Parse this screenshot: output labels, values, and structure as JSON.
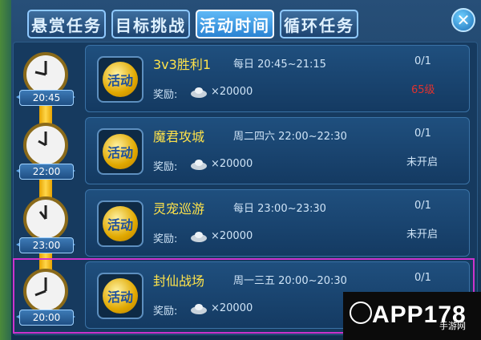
{
  "tabs": [
    {
      "label": "悬赏任务"
    },
    {
      "label": "目标挑战"
    },
    {
      "label": "活动时间"
    },
    {
      "label": "循环任务"
    }
  ],
  "active_tab": "活动时间",
  "close_glyph": "✕",
  "reward_label": "奖励:",
  "badge_text": "活动",
  "events": [
    {
      "time": "20:45",
      "name": "3v3胜利1",
      "schedule": "每日 20:45~21:15",
      "count": "0/1",
      "status": "65级",
      "reward": "×20000"
    },
    {
      "time": "22:00",
      "name": "魔君攻城",
      "schedule": "周二四六 22:00~22:30",
      "count": "0/1",
      "status": "未开启",
      "reward": "×20000"
    },
    {
      "time": "23:00",
      "name": "灵宠巡游",
      "schedule": "每日 23:00~23:30",
      "count": "0/1",
      "status": "未开启",
      "reward": "×20000"
    },
    {
      "time": "20:00",
      "name": "封仙战场",
      "schedule": "周一三五 20:00~20:30",
      "count": "0/1",
      "status": "",
      "reward": "×20000"
    }
  ],
  "status_colors": {
    "level_requirement": "#e1322e",
    "not_open": "#cfe4f7"
  },
  "watermark": {
    "text": "APP178",
    "sub": "手游网"
  }
}
